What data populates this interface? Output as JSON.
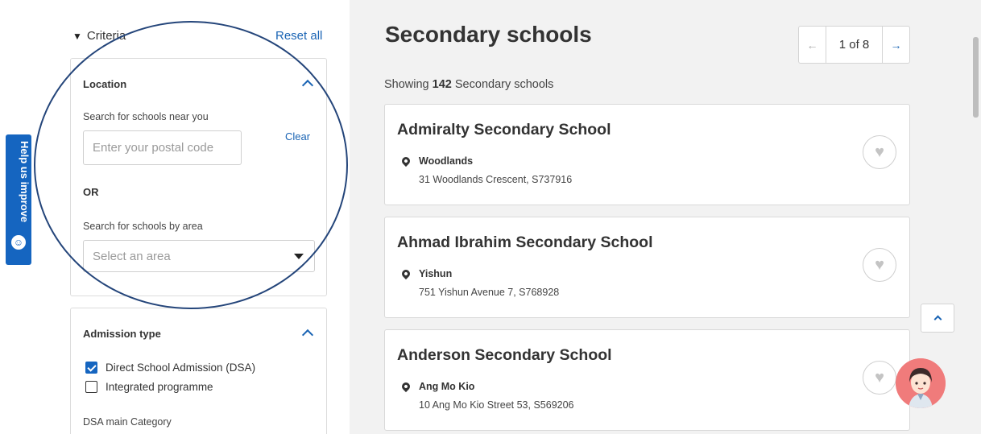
{
  "feedback_tab": {
    "label": "Help us improve",
    "icon": "smiley-icon"
  },
  "filters": {
    "heading": "Criteria",
    "filter_icon": "funnel-icon",
    "reset_label": "Reset all",
    "location": {
      "title": "Location",
      "near_label": "Search for schools near you",
      "postal_placeholder": "Enter your postal code",
      "postal_value": "",
      "clear_label": "Clear",
      "or_label": "OR",
      "area_label": "Search for schools by area",
      "area_placeholder": "Select an area"
    },
    "admission": {
      "title": "Admission type",
      "options": [
        {
          "label": "Direct School Admission (DSA)",
          "checked": true
        },
        {
          "label": "Integrated programme",
          "checked": false
        }
      ],
      "dsa_category_label": "DSA main Category"
    }
  },
  "results": {
    "title": "Secondary schools",
    "pager": {
      "prev": "←",
      "current": "1 of 8",
      "next": "→"
    },
    "showing_prefix": "Showing",
    "count": "142",
    "showing_suffix": "Secondary schools",
    "schools": [
      {
        "name": "Admiralty Secondary School",
        "area": "Woodlands",
        "address": "31 Woodlands Crescent, S737916"
      },
      {
        "name": "Ahmad Ibrahim Secondary School",
        "area": "Yishun",
        "address": "751 Yishun Avenue 7, S768928"
      },
      {
        "name": "Anderson Secondary School",
        "area": "Ang Mo Kio",
        "address": "10 Ang Mo Kio Street 53, S569206"
      }
    ]
  },
  "colors": {
    "accent": "#1a64b4",
    "feedback": "#1565c0",
    "annotation_circle": "#24457a",
    "panel_bg": "#f2f2f2"
  }
}
